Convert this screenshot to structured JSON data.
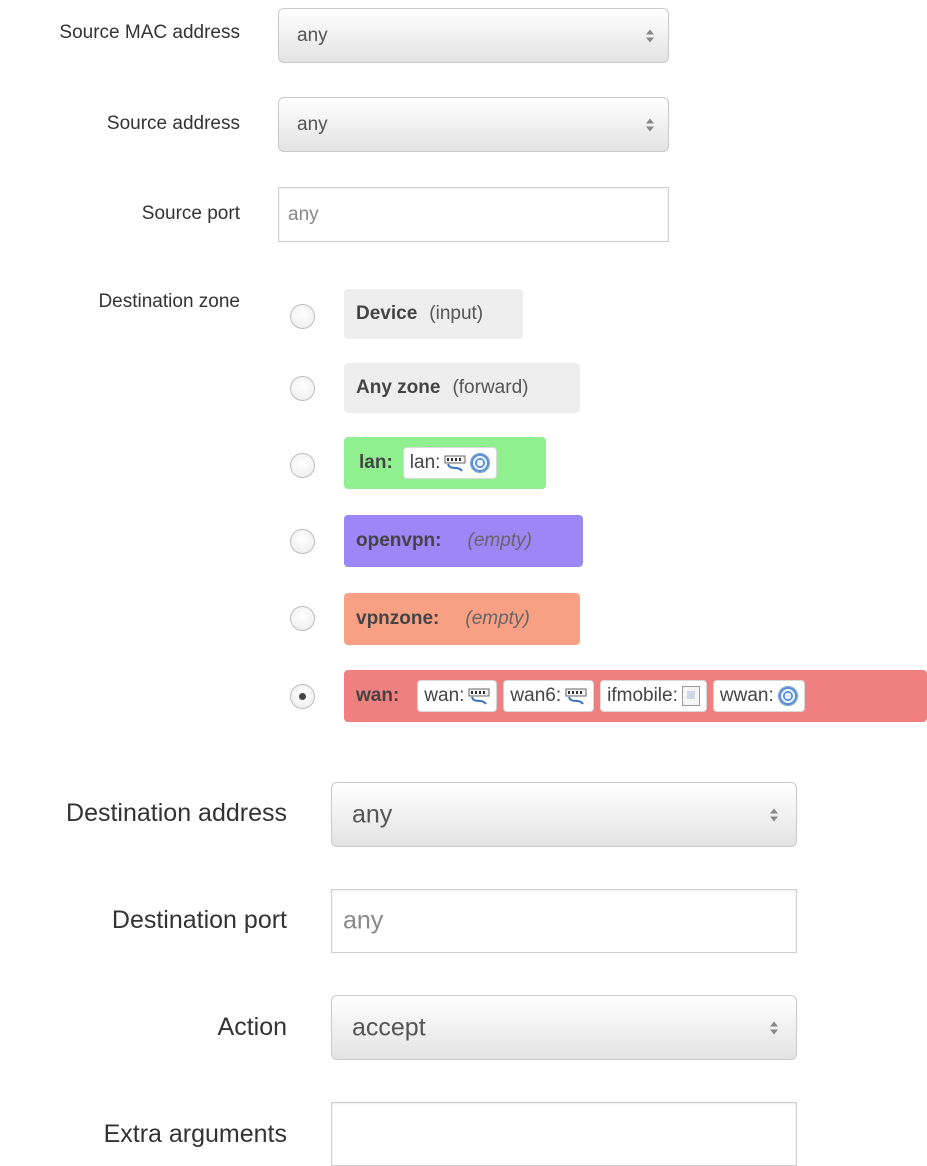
{
  "source_mac": {
    "label": "Source MAC address",
    "value": "any"
  },
  "source_address": {
    "label": "Source address",
    "value": "any"
  },
  "source_port": {
    "label": "Source port",
    "placeholder": "any"
  },
  "destination_zone": {
    "label": "Destination zone",
    "options": [
      {
        "name": "Device",
        "sub": "(input)",
        "color": "#eeeeee",
        "checked": false
      },
      {
        "name": "Any zone",
        "sub": "(forward)",
        "color": "#eeeeee",
        "checked": false
      },
      {
        "name": "lan:",
        "color": "#90f090",
        "devices": [
          {
            "name": "lan:",
            "icons": [
              "ethernet-icon",
              "wifi-icon"
            ]
          }
        ],
        "checked": false
      },
      {
        "name": "openvpn:",
        "empty": "(empty)",
        "color": "#9b87f5",
        "checked": false
      },
      {
        "name": "vpnzone:",
        "empty": "(empty)",
        "color": "#f7a083",
        "checked": false
      },
      {
        "name": "wan:",
        "color": "#f08080",
        "checked": true,
        "devices": [
          {
            "name": "wan:",
            "icons": [
              "ethernet-icon"
            ]
          },
          {
            "name": "wan6:",
            "icons": [
              "ethernet-icon"
            ]
          },
          {
            "name": "ifmobile:",
            "icons": [
              "mobile-icon"
            ]
          },
          {
            "name": "wwan:",
            "icons": [
              "wifi-icon"
            ]
          }
        ]
      }
    ]
  },
  "destination_address": {
    "label": "Destination address",
    "value": "any"
  },
  "destination_port": {
    "label": "Destination port",
    "placeholder": "any"
  },
  "action": {
    "label": "Action",
    "value": "accept"
  },
  "extra_arguments": {
    "label": "Extra arguments",
    "value": ""
  }
}
